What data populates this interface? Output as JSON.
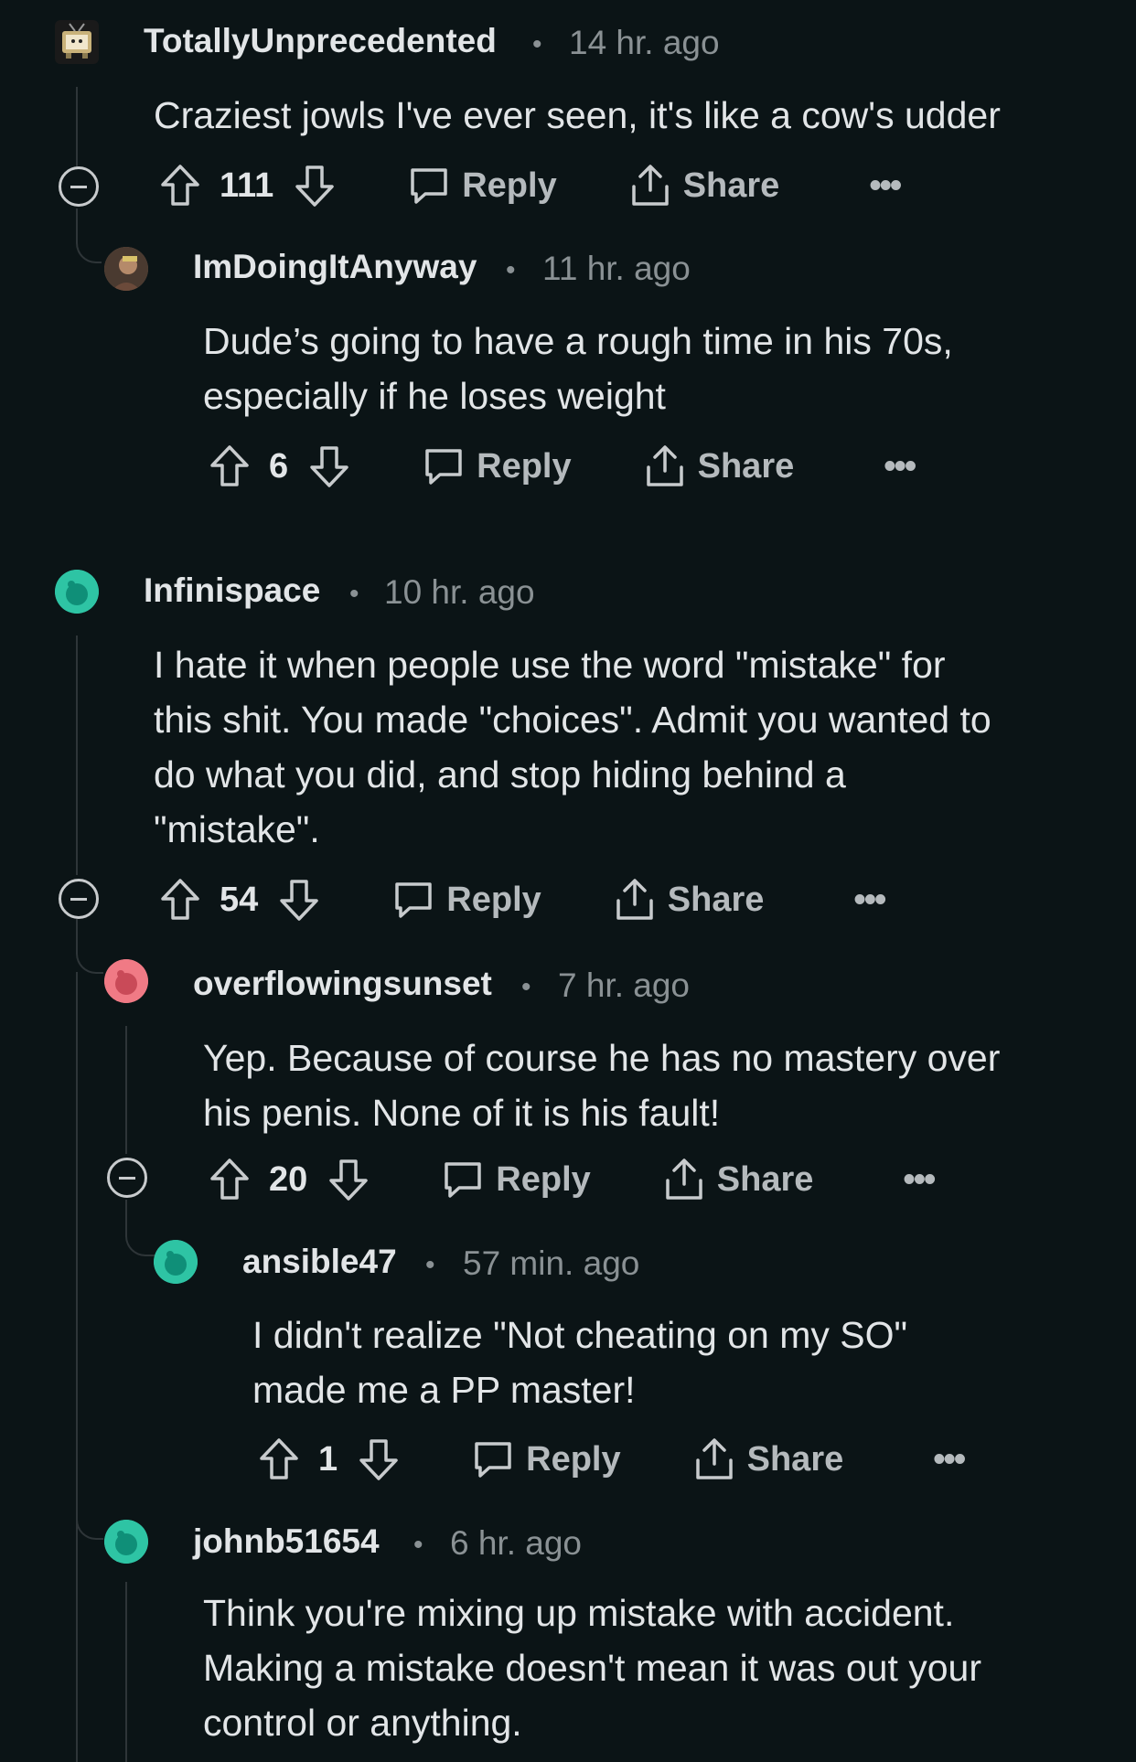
{
  "comments": [
    {
      "username": "TotallyUnprecedented",
      "time": "14 hr. ago",
      "body": "Craziest jowls I've ever seen, it's like a cow's udder",
      "score": "111",
      "reply": "Reply",
      "share": "Share",
      "more": "•••",
      "avatar_color": "#b9a57a"
    },
    {
      "username": "ImDoingItAnyway",
      "time": "11 hr. ago",
      "body": "Dude’s going to have a rough time in his 70s,\nespecially if he loses weight",
      "score": "6",
      "reply": "Reply",
      "share": "Share",
      "more": "•••",
      "avatar_color": "#7a5a46"
    },
    {
      "username": "Infinispace",
      "time": "10 hr. ago",
      "body": "I hate it when people use the word \"mistake\" for\nthis shit. You made \"choices\". Admit you wanted to\ndo what you did, and stop hiding behind a\n\"mistake\".",
      "score": "54",
      "reply": "Reply",
      "share": "Share",
      "more": "•••",
      "avatar_color": "#2ec4a4"
    },
    {
      "username": "overflowingsunset",
      "time": "7 hr. ago",
      "body": "Yep. Because of course he has no mastery over\nhis penis. None of it is his fault!",
      "score": "20",
      "reply": "Reply",
      "share": "Share",
      "more": "•••",
      "avatar_color": "#f07a85"
    },
    {
      "username": "ansible47",
      "time": "57 min. ago",
      "body": "I didn't realize \"Not cheating on my SO\"\nmade me a PP master!",
      "score": "1",
      "reply": "Reply",
      "share": "Share",
      "more": "•••",
      "avatar_color": "#2ec4a4"
    },
    {
      "username": "johnb51654",
      "time": "6 hr. ago",
      "body": "Think you're mixing up mistake with accident.\nMaking a mistake doesn't mean it was out your\ncontrol or anything.",
      "avatar_color": "#2ec4a4"
    }
  ],
  "separator": "•"
}
